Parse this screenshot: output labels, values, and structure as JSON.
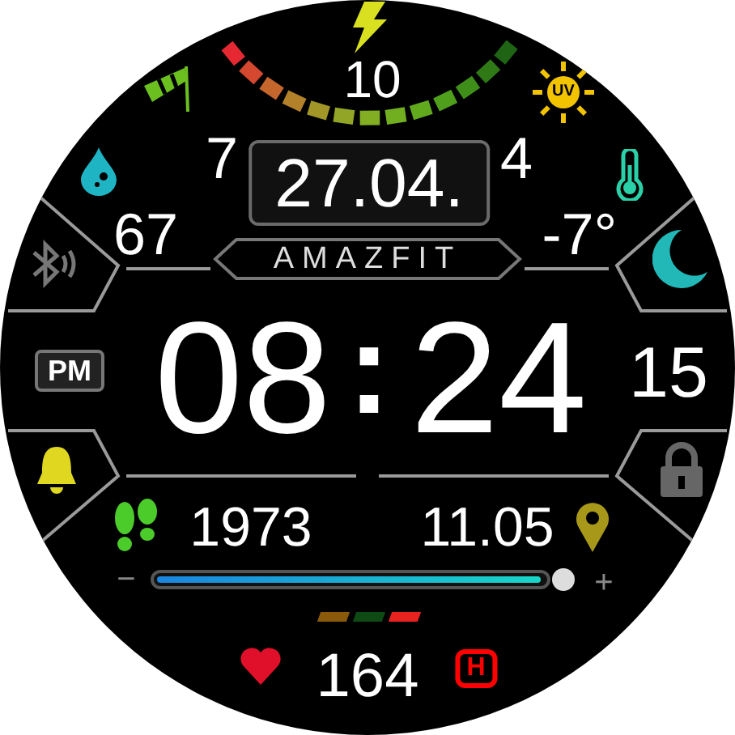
{
  "battery": {
    "reading": "10"
  },
  "uv": {
    "label": "UV",
    "reading": "4"
  },
  "wind": {
    "reading": "7"
  },
  "humidity": {
    "reading": "67"
  },
  "temperature": {
    "reading": "-7°"
  },
  "date": "27.04.",
  "brand": "AMAZFIT",
  "status": {
    "bluetooth": false,
    "dnd": true,
    "alarm": true,
    "locked": false
  },
  "ampm": "PM",
  "time": {
    "hours": "08",
    "separator": ":",
    "minutes": "24",
    "seconds": "15"
  },
  "steps": "1973",
  "distance": "11.05",
  "slider": {
    "minus": "−",
    "plus": "+",
    "level": 0.99
  },
  "zone_bars": [
    {
      "color": "#8a5a0a"
    },
    {
      "color": "#0e4a14"
    },
    {
      "color": "#e8221e"
    }
  ],
  "heart_rate": {
    "reading": "164",
    "zone": "H"
  }
}
